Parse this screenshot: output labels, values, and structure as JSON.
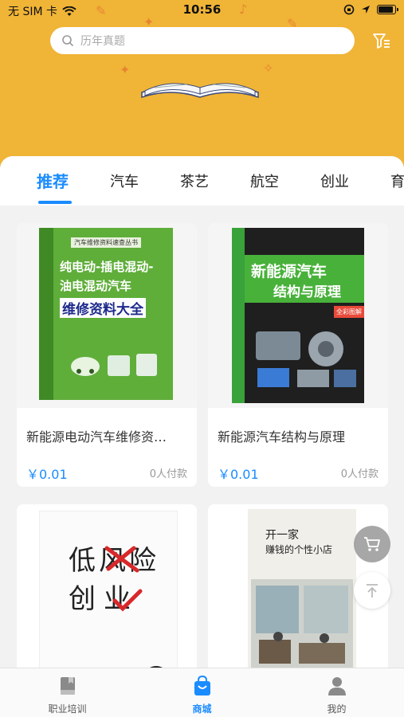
{
  "status_bar": {
    "carrier": "无 SIM 卡",
    "time": "10:56"
  },
  "search": {
    "placeholder": "历年真题"
  },
  "tabs": [
    {
      "label": "推荐",
      "active": true
    },
    {
      "label": "汽车"
    },
    {
      "label": "茶艺"
    },
    {
      "label": "航空"
    },
    {
      "label": "创业"
    },
    {
      "label": "育"
    }
  ],
  "products": [
    {
      "title": "新能源电动汽车维修资…",
      "price": "￥0.01",
      "sold": "0人付款",
      "cover": {
        "series": "汽车维修资料速查丛书",
        "line1": "纯电动-插电混动-",
        "line2": "油电混动汽车",
        "line3": "维修资料大全"
      }
    },
    {
      "title": "新能源汽车结构与原理",
      "price": "￥0.01",
      "sold": "0人付款",
      "cover": {
        "line1": "新能源汽车",
        "line2": "结构与原理",
        "badge": "全彩图解"
      }
    },
    {
      "title": "",
      "cover": {
        "line1": "低风险",
        "line2": "创业"
      }
    },
    {
      "title": "",
      "cover": {
        "line1": "开一家",
        "line2": "赚钱的个性小店"
      }
    }
  ],
  "bottom_tabs": [
    {
      "label": "职业培训",
      "icon": "book-icon"
    },
    {
      "label": "商城",
      "icon": "shopping-bag-icon",
      "active": true
    },
    {
      "label": "我的",
      "icon": "person-icon"
    }
  ],
  "colors": {
    "accent": "#1a8cff",
    "hero_bg": "#f0b437",
    "page_bg": "#f2f2f2"
  }
}
